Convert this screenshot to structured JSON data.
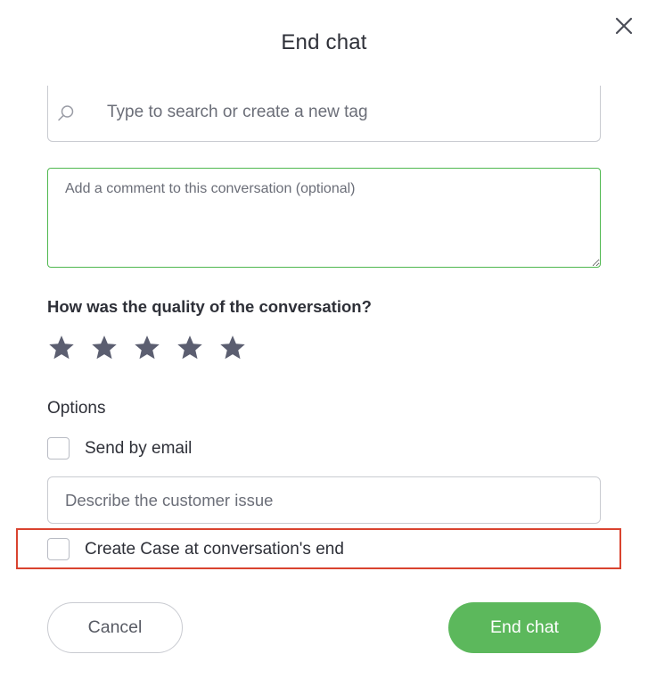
{
  "dialog": {
    "title": "End chat"
  },
  "icons": {
    "close": "close-icon",
    "search": "search-icon",
    "star": "star-icon",
    "resize": "resize-handle-icon"
  },
  "tag_search": {
    "placeholder": "Type to search or create a new tag",
    "value": ""
  },
  "comment": {
    "placeholder": "Add a comment to this conversation (optional)",
    "value": "",
    "border_color": "#4fb84f"
  },
  "rating": {
    "question": "How was the quality of the conversation?",
    "max": 5,
    "value": 0,
    "star_color": "#5b5e70"
  },
  "options": {
    "heading": "Options",
    "send_by_email": {
      "label": "Send by email",
      "checked": false
    },
    "issue": {
      "placeholder": "Describe the customer issue",
      "value": ""
    },
    "create_case": {
      "label": "Create Case at conversation's end",
      "checked": false
    }
  },
  "highlight_color": "#d9432f",
  "buttons": {
    "cancel": "Cancel",
    "end": "End chat",
    "end_color": "#5cb85c"
  }
}
